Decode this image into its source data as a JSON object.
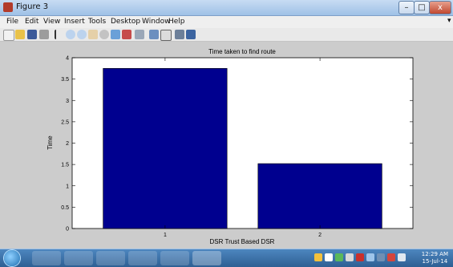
{
  "window": {
    "title": "Figure 3",
    "controls": {
      "minimize": "–",
      "maximize": "□",
      "close": "x"
    }
  },
  "menu": [
    "File",
    "Edit",
    "View",
    "Insert",
    "Tools",
    "Desktop",
    "Window",
    "Help"
  ],
  "toolbar_icons": [
    "new-figure-icon",
    "open-file-icon",
    "save-icon",
    "print-icon",
    "select-arrow-icon",
    "zoom-in-icon",
    "zoom-out-icon",
    "pan-icon",
    "rotate-icon",
    "data-cursor-icon",
    "brush-icon",
    "link-icon",
    "colorbar-icon",
    "legend-icon",
    "hide-plot-tools-icon",
    "show-plot-tools-icon"
  ],
  "chart_data": {
    "type": "bar",
    "title": "Time taken to find route",
    "xlabel": "DSR Trust Based DSR",
    "ylabel": "Time",
    "categories": [
      "1",
      "2"
    ],
    "values": [
      3.75,
      1.52
    ],
    "ylim": [
      0,
      4
    ],
    "yticks": [
      "0",
      "0.5",
      "1",
      "1.5",
      "2",
      "2.5",
      "3",
      "3.5",
      "4"
    ],
    "bar_color": "#00008f",
    "grid": false
  },
  "taskbar": {
    "apps": [
      "internet-explorer-icon",
      "media-player-icon",
      "file-explorer-icon",
      "firefox-icon",
      "paint-icon",
      "matlab-icon"
    ],
    "clock_time": "12:29 AM",
    "clock_date": "15-Jul-14"
  }
}
